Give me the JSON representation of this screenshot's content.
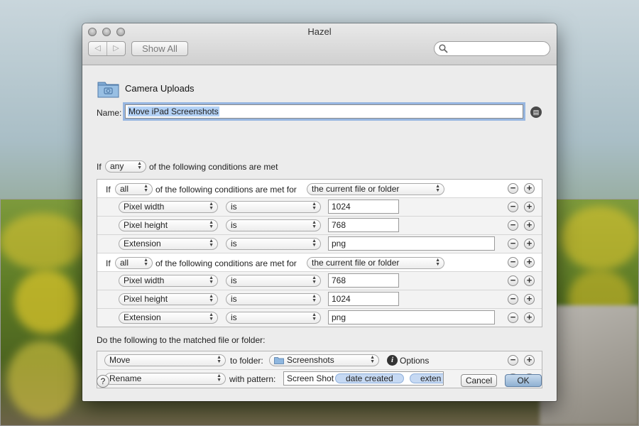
{
  "window": {
    "title": "Hazel"
  },
  "toolbar": {
    "back_glyph": "◁",
    "forward_glyph": "▷",
    "show_all_label": "Show All",
    "search_placeholder": ""
  },
  "folder": {
    "name": "Camera Uploads",
    "icon": "folder-camera-icon"
  },
  "rule": {
    "name_label": "Name:",
    "name_value": "Move iPad Screenshots"
  },
  "conditions": {
    "lead_if": "If",
    "match": "any",
    "suffix": "of the following conditions are met",
    "groups": [
      {
        "if_label": "If",
        "match": "all",
        "middle": "of the following conditions are met for",
        "target": "the current file or folder",
        "rows": [
          {
            "attribute": "Pixel width",
            "operator": "is",
            "value": "1024"
          },
          {
            "attribute": "Pixel height",
            "operator": "is",
            "value": "768"
          },
          {
            "attribute": "Extension",
            "operator": "is",
            "value": "png"
          }
        ]
      },
      {
        "if_label": "If",
        "match": "all",
        "middle": "of the following conditions are met for",
        "target": "the current file or folder",
        "rows": [
          {
            "attribute": "Pixel width",
            "operator": "is",
            "value": "768"
          },
          {
            "attribute": "Pixel height",
            "operator": "is",
            "value": "1024"
          },
          {
            "attribute": "Extension",
            "operator": "is",
            "value": "png"
          }
        ]
      }
    ]
  },
  "actions": {
    "heading": "Do the following to the matched file or folder:",
    "move": {
      "action": "Move",
      "to_label": "to folder:",
      "folder": "Screenshots",
      "options_label": "Options"
    },
    "rename": {
      "action": "Rename",
      "with_label": "with pattern:",
      "text": "Screen Shot",
      "token1": "date created",
      "token2": "exten"
    }
  },
  "buttons": {
    "minus": "−",
    "plus": "+",
    "help": "?",
    "cancel": "Cancel",
    "ok": "OK"
  }
}
